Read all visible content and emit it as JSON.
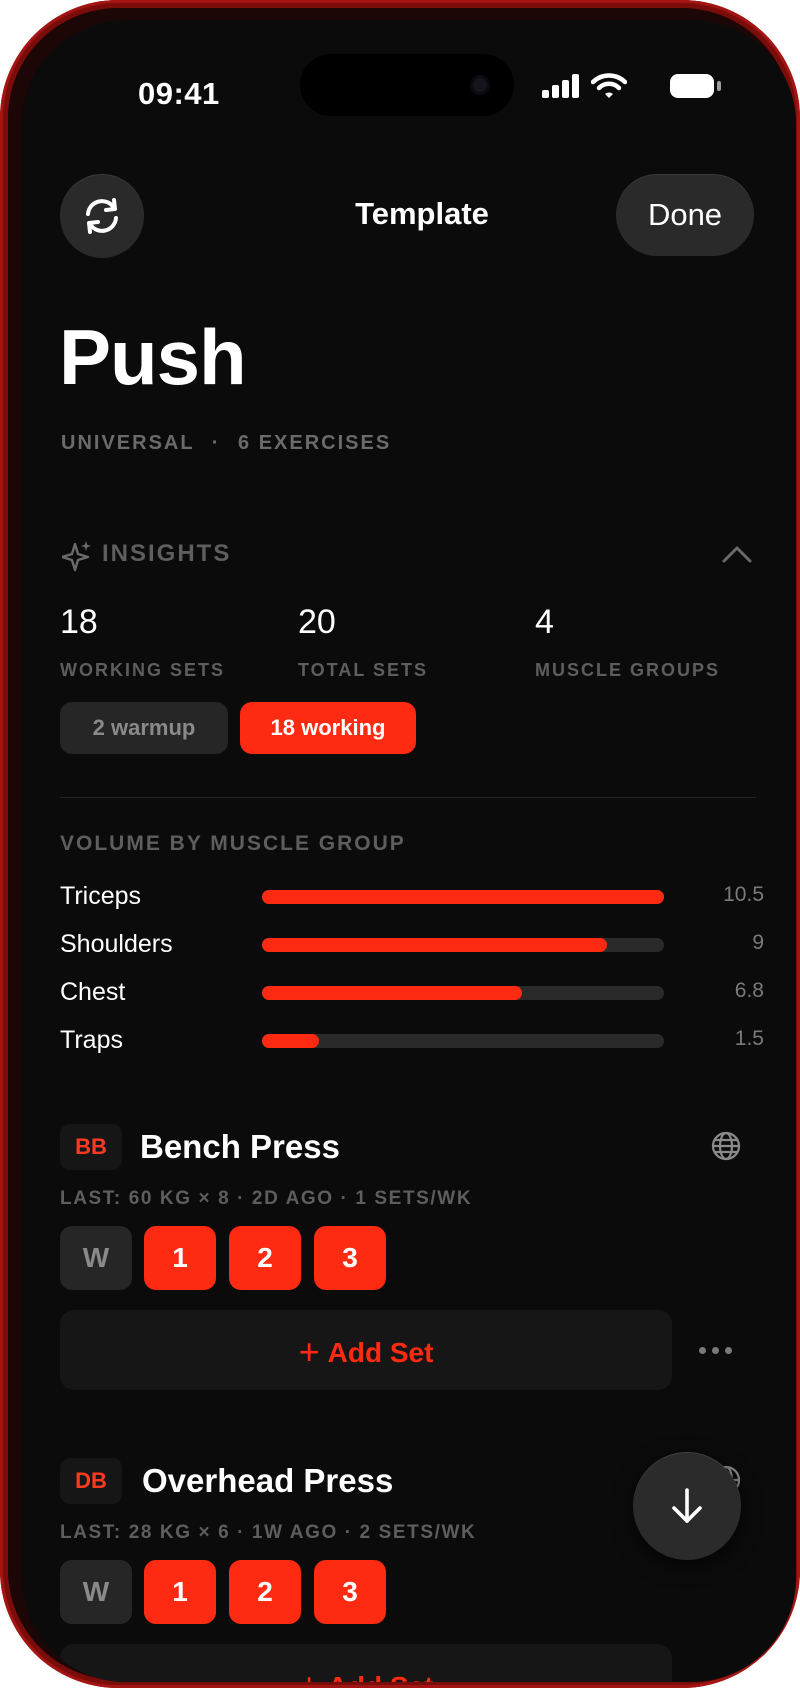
{
  "status_bar": {
    "time": "09:41"
  },
  "header": {
    "title": "Template",
    "done_label": "Done"
  },
  "workout": {
    "name": "Push",
    "meta_category": "UNIVERSAL",
    "meta_separator": "·",
    "meta_exercises": "6 EXERCISES"
  },
  "insights": {
    "label": "INSIGHTS",
    "stats": [
      {
        "value": "18",
        "label": "WORKING SETS"
      },
      {
        "value": "20",
        "label": "TOTAL SETS"
      },
      {
        "value": "4",
        "label": "MUSCLE GROUPS"
      }
    ],
    "pills": {
      "warmup": "2 warmup",
      "working": "18 working"
    },
    "volume_title": "VOLUME BY MUSCLE GROUP",
    "volume": [
      {
        "name": "Triceps",
        "value": "10.5",
        "fraction": 1.0
      },
      {
        "name": "Shoulders",
        "value": "9",
        "fraction": 0.857
      },
      {
        "name": "Chest",
        "value": "6.8",
        "fraction": 0.648
      },
      {
        "name": "Traps",
        "value": "1.5",
        "fraction": 0.143
      }
    ]
  },
  "exercises": [
    {
      "tag": "BB",
      "name": "Bench Press",
      "last": "LAST: 60 KG × 8 · 2D AGO · 1 SETS/WK",
      "sets": [
        "W",
        "1",
        "2",
        "3"
      ],
      "add_set": "Add Set"
    },
    {
      "tag": "DB",
      "name": "Overhead Press",
      "last": "LAST: 28 KG × 6 · 1W AGO · 2 SETS/WK",
      "sets": [
        "W",
        "1",
        "2",
        "3"
      ],
      "add_set": "Add Set"
    }
  ],
  "colors": {
    "accent": "#ff2a12",
    "background": "#0b0b0b",
    "frame": "#7a0c0a"
  },
  "icons": {
    "header_left": "refresh-icon",
    "insights": "sparkle-icon",
    "collapse": "chevron-up-icon",
    "exercise_info": "globe-icon",
    "more": "ellipsis-icon",
    "fab": "arrow-down-icon"
  }
}
